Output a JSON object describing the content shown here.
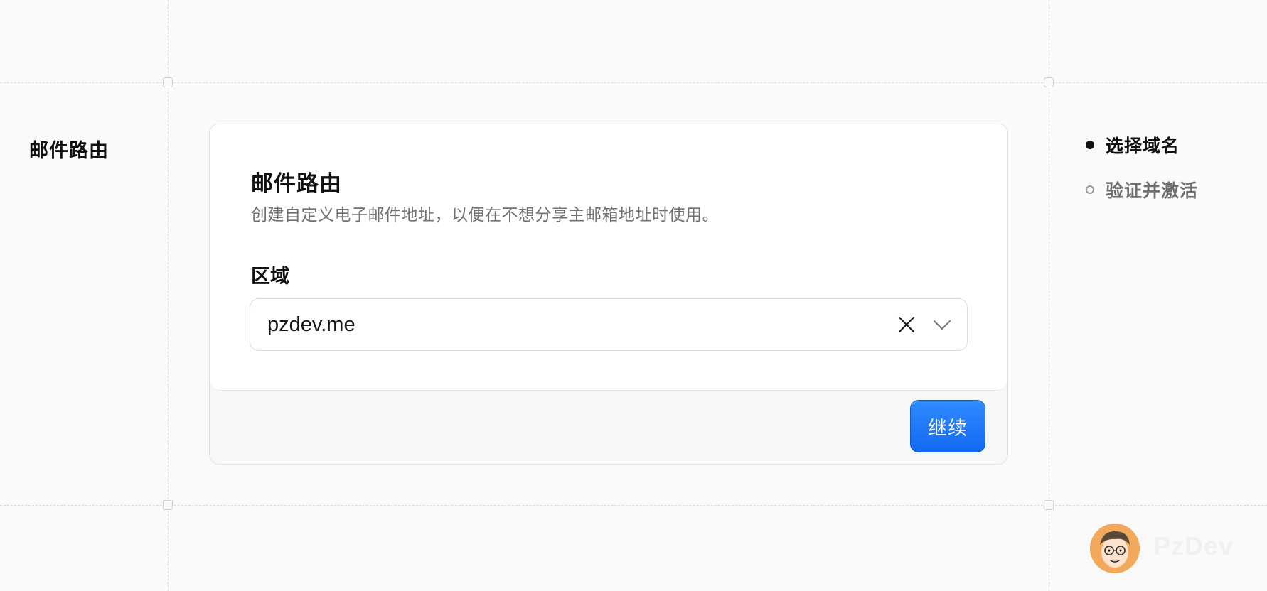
{
  "section": {
    "label": "邮件路由"
  },
  "card": {
    "title": "邮件路由",
    "description": "创建自定义电子邮件地址，以便在不想分享主邮箱地址时使用。",
    "field_label": "区域",
    "select": {
      "value": "pzdev.me",
      "clear_icon": "close-icon",
      "dropdown_icon": "chevron-down-icon"
    },
    "continue_label": "继续"
  },
  "steps": [
    {
      "label": "选择域名",
      "state": "active"
    },
    {
      "label": "验证并激活",
      "state": "inactive"
    }
  ],
  "watermark": {
    "text": "PzDev",
    "avatar_icon": "cartoon-face-avatar"
  },
  "colors": {
    "accent": "#1d74f5",
    "background": "#fafafa",
    "card": "#ffffff",
    "footer": "#f6f7f7"
  }
}
